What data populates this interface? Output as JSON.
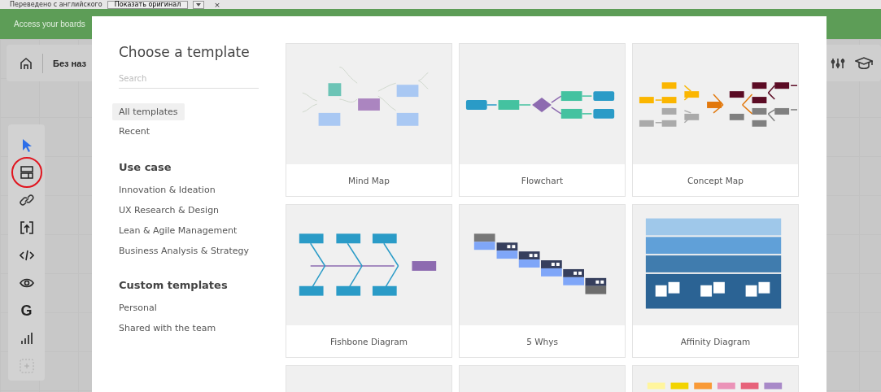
{
  "translate_bar": {
    "text": "Переведено с английского",
    "button": "Показать оригинал",
    "close": "×"
  },
  "banner": {
    "text": "Access your boards"
  },
  "board_toolbar": {
    "title": "Без наз"
  },
  "tools": [
    {
      "kind": "pointer",
      "circled": false
    },
    {
      "kind": "templates",
      "circled": true
    },
    {
      "kind": "link",
      "circled": false
    },
    {
      "kind": "upload",
      "circled": false
    },
    {
      "kind": "code",
      "circled": false
    },
    {
      "kind": "eye",
      "circled": false
    },
    {
      "kind": "letter",
      "label": "G",
      "circled": false
    },
    {
      "kind": "chart",
      "circled": false
    },
    {
      "kind": "add",
      "circled": false
    }
  ],
  "modal": {
    "title": "Choose a template",
    "search": {
      "placeholder": "Search"
    },
    "nav": [
      {
        "label": "All templates",
        "selected": true
      },
      {
        "label": "Recent",
        "selected": false
      }
    ],
    "sections": [
      {
        "heading": "Use case",
        "items": [
          "Innovation & Ideation",
          "UX Research & Design",
          "Lean & Agile Management",
          "Business Analysis & Strategy"
        ]
      },
      {
        "heading": "Custom templates",
        "items": [
          "Personal",
          "Shared with the team"
        ]
      }
    ],
    "templates": [
      {
        "kind": "mindmap",
        "label": "Mind Map"
      },
      {
        "kind": "flowchart",
        "label": "Flowchart"
      },
      {
        "kind": "conceptmap",
        "label": "Concept Map"
      },
      {
        "kind": "fishbone",
        "label": "Fishbone Diagram"
      },
      {
        "kind": "whys",
        "label": "5 Whys"
      },
      {
        "kind": "affinity",
        "label": "Affinity Diagram"
      },
      {
        "kind": "blank"
      },
      {
        "kind": "blank"
      },
      {
        "kind": "swatches"
      }
    ]
  }
}
